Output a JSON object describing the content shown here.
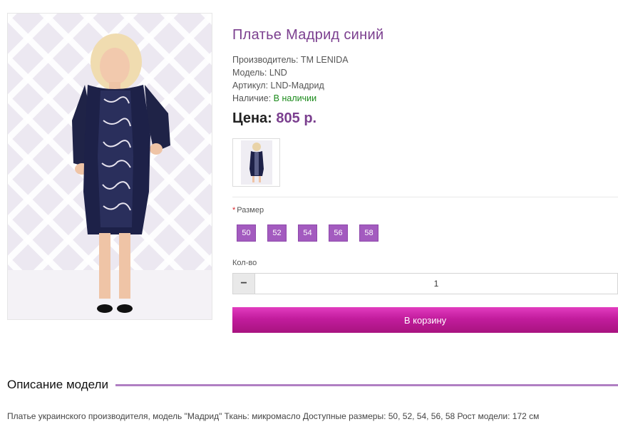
{
  "product": {
    "title": "Платье Мадрид синий",
    "manufacturer": "Производитель: ТМ LENIDA",
    "model": "Модель: LND",
    "article": "Артикул: LND-Мадрид",
    "availability_label": "Наличие: ",
    "availability_value": "В наличии",
    "price_label": "Цена:",
    "price_value": "805 р."
  },
  "options": {
    "size_required_mark": "*",
    "size_label": "Размер",
    "sizes": [
      "50",
      "52",
      "54",
      "56",
      "58"
    ]
  },
  "quantity": {
    "label": "Кол-во",
    "minus": "−",
    "value": "1"
  },
  "cart_button": "В корзину",
  "description": {
    "heading": "Описание модели",
    "text": "Платье украинского производителя, модель \"Мадрид\" Ткань: микромасло Доступные размеры: 50, 52, 54, 56, 58 Рост модели: 172 см"
  },
  "colors": {
    "accent": "#7b3f8f",
    "size_button": "#a35bbf",
    "cart_button": "#c21c9d",
    "in_stock": "#1a8a1a"
  }
}
